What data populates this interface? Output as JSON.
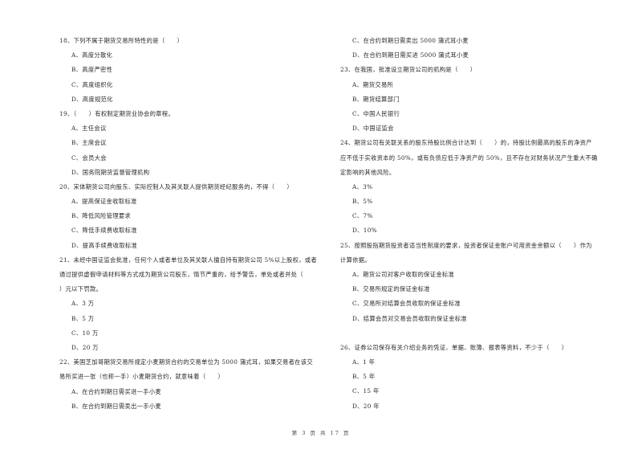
{
  "document": {
    "left_column": [
      {
        "number": "18",
        "stem": "18、下列不属于期货交易所特性的是（　　）",
        "options": [
          "A、高度分散化",
          "B、高度严密性",
          "C、高度组织化",
          "D、高度规范化"
        ]
      },
      {
        "number": "19",
        "stem": "19、（　　）有权制定期货业协会的章程。",
        "options": [
          "A、主任会议",
          "B、主席会议",
          "C、会员大会",
          "D、国务院期货监督管理机构"
        ]
      },
      {
        "number": "20",
        "stem": "20、宋体期货公司向股东、实际控制人及其关联人提供期货经纪服务的，不得（　　）",
        "options": [
          "A、提高保证金收取标准",
          "B、降低风险管理要求",
          "C、降低手续费收取标准",
          "D、提高手续费收取标准"
        ]
      },
      {
        "number": "21",
        "stem_lines": [
          "21、未经中国证监会批准，任何个人或者单位及其关联人擅自持有期货公司 5%以上股权，或者",
          "通过提供虚假申请材料等方式成为期货公司股东，情节严重的，给予警告，单处或者并处（",
          "）元以下罚款。"
        ],
        "options": [
          "A、3 万",
          "B、5 万",
          "C、10 万",
          "D、20 万"
        ]
      },
      {
        "number": "22",
        "stem_lines": [
          "22、美国芝加哥期货交易所规定小麦期货合约的交易单位为 5000 蒲式耳，如果交易者在该交",
          "易所买进一张（也称一手）小麦期货合约，就意味着（　　）"
        ],
        "options": [
          "A、在合约到期日需买进一手小麦",
          "B、在合约到期日需卖出一手小麦"
        ]
      }
    ],
    "right_column": [
      {
        "continued_options": [
          "C、在合约到期日需卖出 5000 蒲式耳小麦",
          "D、在合约到期日需买进 5000 蒲式耳小麦"
        ]
      },
      {
        "number": "23",
        "stem": "23、在我国，批准设立期货公司的机构是（　　）",
        "options": [
          "A、期货交易所",
          "B、期货结算部门",
          "C、中国人民银行",
          "D、中国证监会"
        ]
      },
      {
        "number": "24",
        "stem_lines": [
          "24、期货公司有关联关系的股东持股比例合计达到（　　）的，持股比例最高的股东的净资产",
          "应不低于实收资本的 50%，或有负债应低于净资产的 50%，且不存在对财务状况产生重大不确",
          "定影响的其他风险。"
        ],
        "options": [
          "A、3%",
          "B、5%",
          "C、7%",
          "D、10%"
        ]
      },
      {
        "number": "25",
        "stem_lines": [
          "25、按照股指期货投资者适当性制度的要求，投资者保证金账户可用资金余额以（　　）作为",
          "计算依据。"
        ],
        "options": [
          "A、期货公司对客户收取的保证金标准",
          "B、交易所规定的保证金标准",
          "C、交易所对结算会员收取的保证金标准",
          "D、结算会员对交易会员收取的保证金标准"
        ]
      },
      {
        "number": "26",
        "stem": "26、证券公司保存有关介绍业务的凭证、单据、账簿、报表等资料，不少于（　　）",
        "options": [
          "A、1 年",
          "B、5 年",
          "C、15 年",
          "D、20 年"
        ]
      }
    ],
    "footer": "第 3 页 共 17 页"
  }
}
